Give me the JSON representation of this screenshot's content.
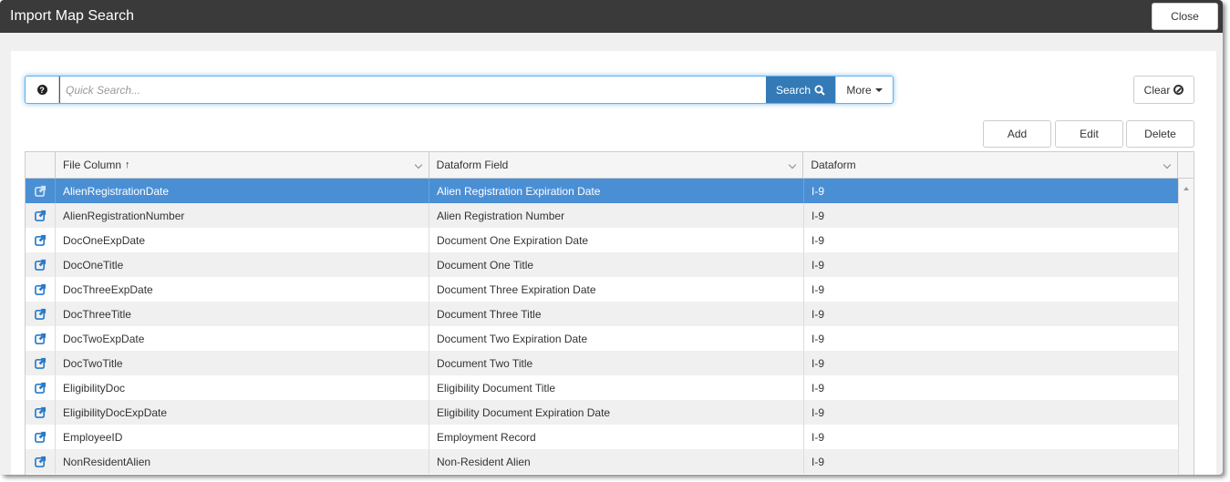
{
  "window": {
    "title": "Import Map Search",
    "close_label": "Close"
  },
  "search": {
    "placeholder": "Quick Search...",
    "value": "",
    "search_label": "Search",
    "more_label": "More",
    "help_icon": "question-circle-icon"
  },
  "toolbar": {
    "clear_label": "Clear",
    "add_label": "Add",
    "edit_label": "Edit",
    "delete_label": "Delete"
  },
  "grid": {
    "columns": [
      {
        "label": "File Column",
        "sorted": "ascending"
      },
      {
        "label": "Dataform Field"
      },
      {
        "label": "Dataform"
      }
    ],
    "selected_row": 0,
    "rows": [
      {
        "file_column": "AlienRegistrationDate",
        "dataform_field": "Alien Registration Expiration Date",
        "dataform": "I-9"
      },
      {
        "file_column": "AlienRegistrationNumber",
        "dataform_field": "Alien Registration Number",
        "dataform": "I-9"
      },
      {
        "file_column": "DocOneExpDate",
        "dataform_field": "Document One Expiration Date",
        "dataform": "I-9"
      },
      {
        "file_column": "DocOneTitle",
        "dataform_field": "Document One Title",
        "dataform": "I-9"
      },
      {
        "file_column": "DocThreeExpDate",
        "dataform_field": "Document Three Expiration Date",
        "dataform": "I-9"
      },
      {
        "file_column": "DocThreeTitle",
        "dataform_field": "Document Three Title",
        "dataform": "I-9"
      },
      {
        "file_column": "DocTwoExpDate",
        "dataform_field": "Document Two Expiration Date",
        "dataform": "I-9"
      },
      {
        "file_column": "DocTwoTitle",
        "dataform_field": "Document Two Title",
        "dataform": "I-9"
      },
      {
        "file_column": "EligibilityDoc",
        "dataform_field": "Eligibility Document Title",
        "dataform": "I-9"
      },
      {
        "file_column": "EligibilityDocExpDate",
        "dataform_field": "Eligibility Document Expiration Date",
        "dataform": "I-9"
      },
      {
        "file_column": "EmployeeID",
        "dataform_field": "Employment Record",
        "dataform": "I-9"
      },
      {
        "file_column": "NonResidentAlien",
        "dataform_field": "Non-Resident Alien",
        "dataform": "I-9"
      }
    ]
  },
  "colors": {
    "accent": "#337ab7",
    "selected_row": "#4a8fd4",
    "link_icon": "#2a7bc8",
    "titlebar": "#3a3a3a"
  }
}
